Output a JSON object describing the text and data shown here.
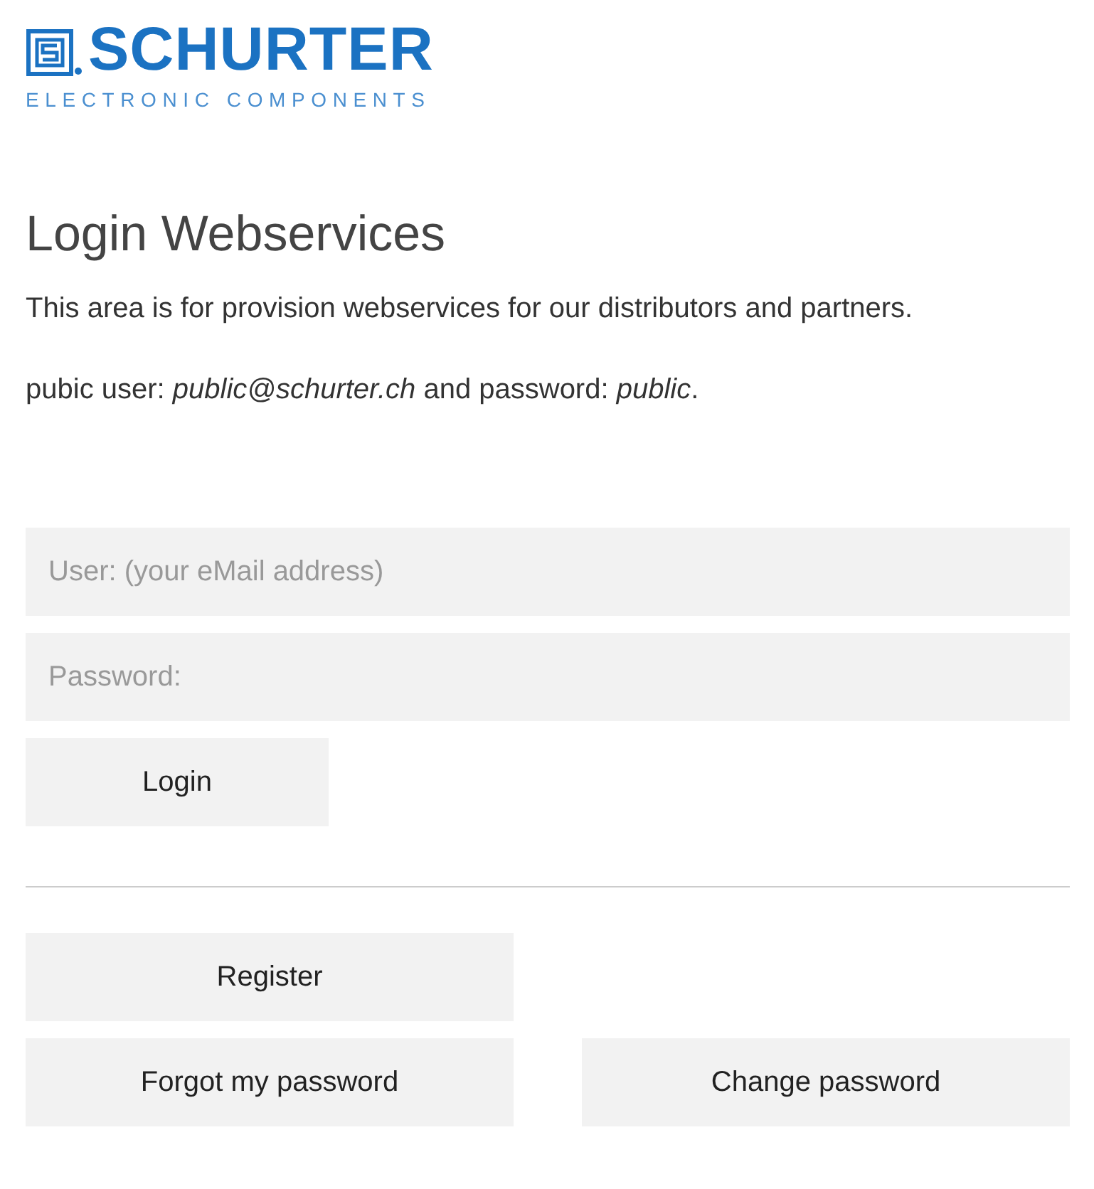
{
  "logo": {
    "brand": "SCHURTER",
    "tagline": "ELECTRONIC COMPONENTS"
  },
  "title": "Login Webservices",
  "intro": "This area is for provision webservices for our distributors and partners.",
  "credentials": "pubic user: *public@schurter.ch* and password: *public*.",
  "fields": [
    {
      "placeholder": "User: (your eMail address)"
    },
    {
      "placeholder": "Password:"
    }
  ],
  "login_button": "Login",
  "register_button": "Register",
  "forgot_button": "Forgot my password",
  "change_button": "Change password"
}
